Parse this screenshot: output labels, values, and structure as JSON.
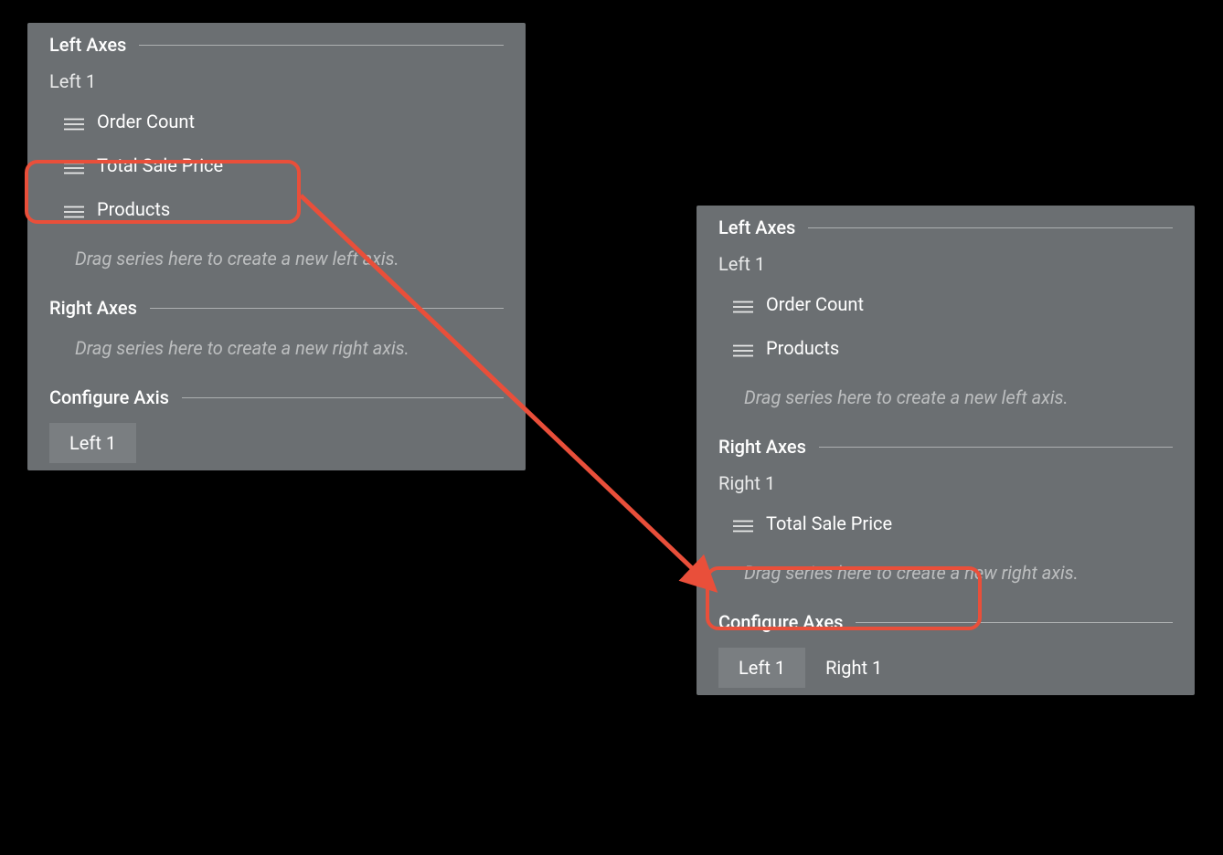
{
  "annotation_color": "#e94f3a",
  "panels": {
    "left": {
      "sections": {
        "left_axes": {
          "title": "Left Axes",
          "axis_label": "Left 1",
          "series": [
            "Order Count",
            "Total Sale Price",
            "Products"
          ],
          "drop_hint": "Drag series here to create a new left axis."
        },
        "right_axes": {
          "title": "Right Axes",
          "drop_hint": "Drag series here to create a new right axis."
        },
        "configure": {
          "title": "Configure Axis",
          "tabs": [
            "Left 1"
          ],
          "active_tab": 0
        }
      }
    },
    "right": {
      "sections": {
        "left_axes": {
          "title": "Left Axes",
          "axis_label": "Left 1",
          "series": [
            "Order Count",
            "Products"
          ],
          "drop_hint": "Drag series here to create a new left axis."
        },
        "right_axes": {
          "title": "Right Axes",
          "axis_label": "Right 1",
          "series": [
            "Total Sale Price"
          ],
          "drop_hint": "Drag series here to create a new right axis."
        },
        "configure": {
          "title": "Configure Axes",
          "tabs": [
            "Left 1",
            "Right 1"
          ],
          "active_tab": 0
        }
      }
    }
  }
}
